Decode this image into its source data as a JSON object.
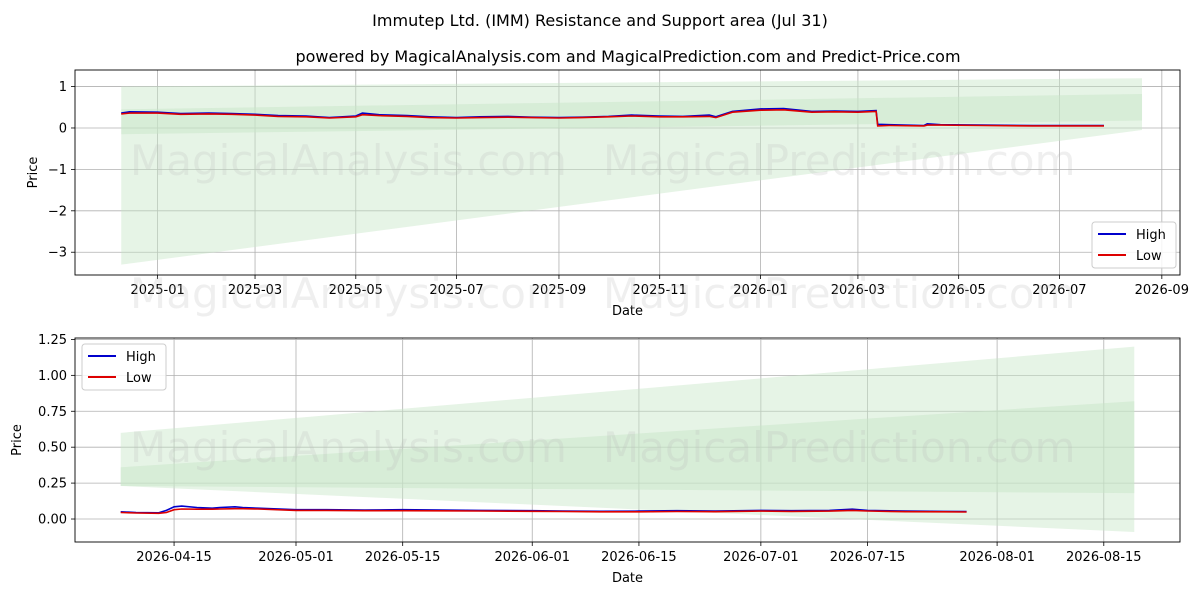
{
  "title": "Immutep Ltd. (IMM) Resistance and Support area (Jul 31)",
  "subtitle": "powered by MagicalAnalysis.com and MagicalPrediction.com and Predict-Price.com",
  "watermarks": [
    "MagicalAnalysis.com",
    "MagicalPrediction.com"
  ],
  "colors": {
    "high": "#0000cc",
    "low": "#dd0000",
    "band": "#c8e6c8",
    "grid": "#b0b0b0"
  },
  "chart_data": [
    {
      "type": "line",
      "xlabel": "Date",
      "ylabel": "Price",
      "x_ticks": [
        "2025-01",
        "2025-03",
        "2025-05",
        "2025-07",
        "2025-09",
        "2025-11",
        "2026-01",
        "2026-03",
        "2026-05",
        "2026-07",
        "2026-09"
      ],
      "y_ticks": [
        "1",
        "0",
        "−1",
        "−2",
        "−3"
      ],
      "xlim": [
        "2024-11-12",
        "2026-09-12"
      ],
      "ylim": [
        -3.55,
        1.4
      ],
      "grid": true,
      "legend": {
        "position": "bottom-right",
        "entries": [
          "High",
          "Low"
        ]
      },
      "bands": [
        {
          "x": [
            "2024-12-10",
            "2026-08-20"
          ],
          "upper": [
            1.0,
            1.2
          ],
          "lower": [
            -3.3,
            -0.05
          ],
          "opacity": 0.45
        },
        {
          "x": [
            "2024-12-10",
            "2026-08-20"
          ],
          "upper": [
            0.45,
            0.82
          ],
          "lower": [
            -0.15,
            0.18
          ],
          "opacity": 0.5
        }
      ],
      "series": [
        {
          "name": "High",
          "x": [
            "2024-12-10",
            "2024-12-15",
            "2025-01-01",
            "2025-01-15",
            "2025-02-01",
            "2025-02-15",
            "2025-03-01",
            "2025-03-15",
            "2025-04-01",
            "2025-04-15",
            "2025-05-01",
            "2025-05-05",
            "2025-05-15",
            "2025-06-01",
            "2025-06-15",
            "2025-07-01",
            "2025-07-15",
            "2025-08-01",
            "2025-08-15",
            "2025-09-01",
            "2025-09-15",
            "2025-10-01",
            "2025-10-15",
            "2025-11-01",
            "2025-11-15",
            "2025-12-01",
            "2025-12-05",
            "2025-12-15",
            "2026-01-01",
            "2026-01-15",
            "2026-02-01",
            "2026-02-15",
            "2026-03-01",
            "2026-03-12",
            "2026-03-13",
            "2026-03-20",
            "2026-04-10",
            "2026-04-12",
            "2026-04-20",
            "2026-05-15",
            "2026-06-15",
            "2026-07-15",
            "2026-07-28"
          ],
          "values": [
            0.36,
            0.39,
            0.38,
            0.35,
            0.36,
            0.35,
            0.33,
            0.3,
            0.29,
            0.25,
            0.29,
            0.36,
            0.32,
            0.3,
            0.27,
            0.25,
            0.27,
            0.28,
            0.26,
            0.25,
            0.26,
            0.28,
            0.31,
            0.29,
            0.28,
            0.31,
            0.27,
            0.4,
            0.46,
            0.47,
            0.4,
            0.41,
            0.4,
            0.42,
            0.09,
            0.08,
            0.06,
            0.1,
            0.08,
            0.07,
            0.06,
            0.06,
            0.06
          ]
        },
        {
          "name": "Low",
          "x": [
            "2024-12-10",
            "2024-12-15",
            "2025-01-01",
            "2025-01-15",
            "2025-02-01",
            "2025-02-15",
            "2025-03-01",
            "2025-03-15",
            "2025-04-01",
            "2025-04-15",
            "2025-05-01",
            "2025-05-05",
            "2025-05-15",
            "2025-06-01",
            "2025-06-15",
            "2025-07-01",
            "2025-07-15",
            "2025-08-01",
            "2025-08-15",
            "2025-09-01",
            "2025-09-15",
            "2025-10-01",
            "2025-10-15",
            "2025-11-01",
            "2025-11-15",
            "2025-12-01",
            "2025-12-05",
            "2025-12-15",
            "2026-01-01",
            "2026-01-15",
            "2026-02-01",
            "2026-02-15",
            "2026-03-01",
            "2026-03-12",
            "2026-03-13",
            "2026-03-20",
            "2026-04-10",
            "2026-04-12",
            "2026-04-20",
            "2026-05-15",
            "2026-06-15",
            "2026-07-15",
            "2026-07-28"
          ],
          "values": [
            0.34,
            0.36,
            0.36,
            0.33,
            0.34,
            0.33,
            0.31,
            0.28,
            0.27,
            0.24,
            0.27,
            0.32,
            0.3,
            0.28,
            0.25,
            0.24,
            0.25,
            0.26,
            0.25,
            0.24,
            0.25,
            0.27,
            0.29,
            0.27,
            0.27,
            0.28,
            0.25,
            0.38,
            0.43,
            0.44,
            0.38,
            0.39,
            0.38,
            0.4,
            0.05,
            0.06,
            0.05,
            0.07,
            0.07,
            0.06,
            0.05,
            0.05,
            0.05
          ]
        }
      ]
    },
    {
      "type": "line",
      "xlabel": "Date",
      "ylabel": "Price",
      "x_ticks": [
        "2026-04-15",
        "2026-05-01",
        "2026-05-15",
        "2026-06-01",
        "2026-06-15",
        "2026-07-01",
        "2026-07-15",
        "2026-08-01",
        "2026-08-15"
      ],
      "y_ticks": [
        "1.25",
        "1.00",
        "0.75",
        "0.50",
        "0.25",
        "0.00"
      ],
      "xlim": [
        "2026-04-02",
        "2026-08-25"
      ],
      "ylim": [
        -0.16,
        1.26
      ],
      "grid": true,
      "legend": {
        "position": "top-left",
        "entries": [
          "High",
          "Low"
        ]
      },
      "bands": [
        {
          "x": [
            "2026-04-08",
            "2026-08-19"
          ],
          "upper": [
            0.6,
            1.2
          ],
          "lower": [
            0.23,
            -0.09
          ],
          "opacity": 0.45
        },
        {
          "x": [
            "2026-04-08",
            "2026-08-19"
          ],
          "upper": [
            0.36,
            0.82
          ],
          "lower": [
            0.23,
            0.18
          ],
          "opacity": 0.5
        }
      ],
      "series": [
        {
          "name": "High",
          "x": [
            "2026-04-08",
            "2026-04-10",
            "2026-04-13",
            "2026-04-14",
            "2026-04-15",
            "2026-04-16",
            "2026-04-18",
            "2026-04-20",
            "2026-04-21",
            "2026-04-23",
            "2026-04-24",
            "2026-04-26",
            "2026-05-01",
            "2026-05-05",
            "2026-05-10",
            "2026-05-15",
            "2026-05-20",
            "2026-05-25",
            "2026-06-01",
            "2026-06-05",
            "2026-06-10",
            "2026-06-15",
            "2026-06-20",
            "2026-06-25",
            "2026-07-01",
            "2026-07-05",
            "2026-07-10",
            "2026-07-13",
            "2026-07-15",
            "2026-07-20",
            "2026-07-25",
            "2026-07-28"
          ],
          "values": [
            0.05,
            0.045,
            0.043,
            0.06,
            0.085,
            0.09,
            0.08,
            0.075,
            0.08,
            0.085,
            0.08,
            0.075,
            0.065,
            0.065,
            0.062,
            0.065,
            0.062,
            0.06,
            0.058,
            0.056,
            0.054,
            0.055,
            0.058,
            0.056,
            0.06,
            0.058,
            0.06,
            0.068,
            0.06,
            0.055,
            0.053,
            0.052
          ]
        },
        {
          "name": "Low",
          "x": [
            "2026-04-08",
            "2026-04-10",
            "2026-04-13",
            "2026-04-14",
            "2026-04-15",
            "2026-04-16",
            "2026-04-18",
            "2026-04-20",
            "2026-04-21",
            "2026-04-23",
            "2026-04-24",
            "2026-04-26",
            "2026-05-01",
            "2026-05-05",
            "2026-05-10",
            "2026-05-15",
            "2026-05-20",
            "2026-05-25",
            "2026-06-01",
            "2026-06-05",
            "2026-06-10",
            "2026-06-15",
            "2026-06-20",
            "2026-06-25",
            "2026-07-01",
            "2026-07-05",
            "2026-07-10",
            "2026-07-13",
            "2026-07-15",
            "2026-07-20",
            "2026-07-25",
            "2026-07-28"
          ],
          "values": [
            0.045,
            0.042,
            0.04,
            0.045,
            0.065,
            0.07,
            0.068,
            0.068,
            0.07,
            0.072,
            0.072,
            0.07,
            0.06,
            0.06,
            0.058,
            0.058,
            0.057,
            0.056,
            0.054,
            0.052,
            0.05,
            0.05,
            0.052,
            0.051,
            0.055,
            0.053,
            0.055,
            0.06,
            0.056,
            0.051,
            0.05,
            0.049
          ]
        }
      ]
    }
  ]
}
